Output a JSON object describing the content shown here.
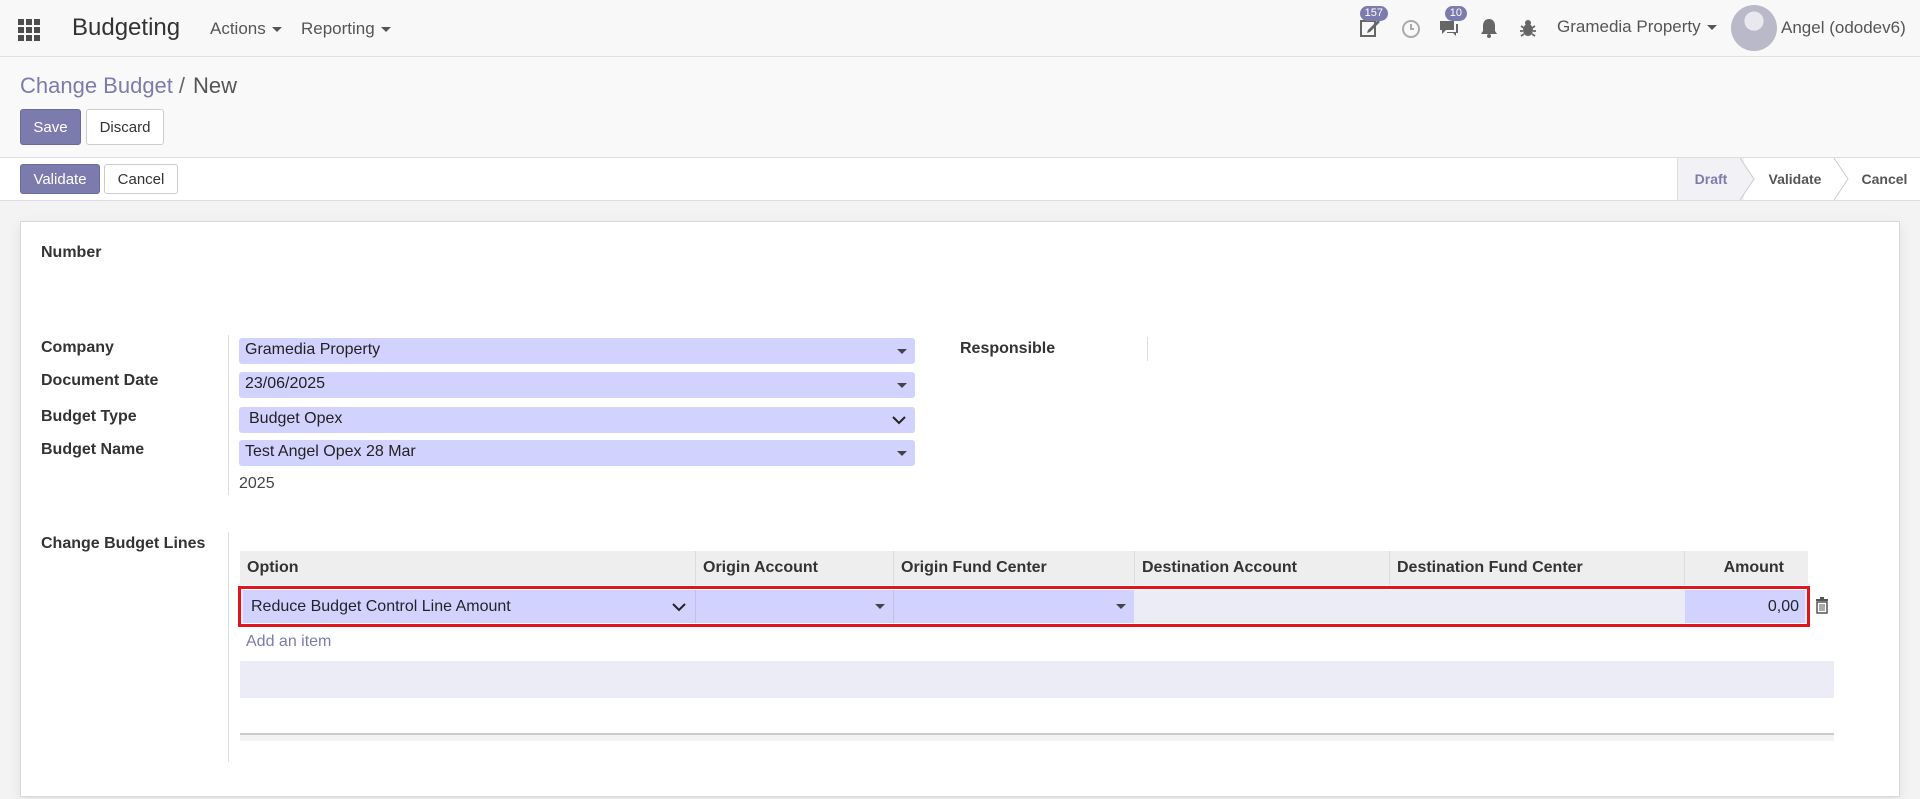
{
  "navbar": {
    "app_name": "Budgeting",
    "menus": [
      "Actions",
      "Reporting"
    ],
    "activity_badge": "157",
    "messages_badge": "10",
    "company": "Gramedia Property",
    "user": "Angel (ododev6)"
  },
  "breadcrumb": {
    "parent": "Change Budget",
    "separator": "/",
    "current": "New"
  },
  "buttons": {
    "save": "Save",
    "discard": "Discard",
    "validate": "Validate",
    "cancel": "Cancel"
  },
  "status_stages": [
    "Draft",
    "Validate",
    "Cancel"
  ],
  "status_active": "Draft",
  "form": {
    "number_label": "Number",
    "company_label": "Company",
    "company_value": "Gramedia Property",
    "document_date_label": "Document Date",
    "document_date_value": "23/06/2025",
    "budget_type_label": "Budget Type",
    "budget_type_value": "Budget Opex",
    "budget_name_label": "Budget Name",
    "budget_name_value": "Test Angel Opex 28 Mar",
    "budget_year": "2025",
    "responsible_label": "Responsible",
    "lines_label": "Change Budget Lines"
  },
  "lines_table": {
    "columns": [
      "Option",
      "Origin Account",
      "Origin Fund Center",
      "Destination Account",
      "Destination Fund Center",
      "Amount"
    ],
    "rows": [
      {
        "option": "Reduce Budget Control Line Amount",
        "origin_account": "",
        "origin_fund_center": "",
        "destination_account": "",
        "destination_fund_center": "",
        "amount": "0,00"
      }
    ],
    "add_item": "Add an item"
  },
  "colors": {
    "primary": "#7c7bad",
    "input_bg": "#d2d2ff",
    "highlight": "#e0151e"
  }
}
